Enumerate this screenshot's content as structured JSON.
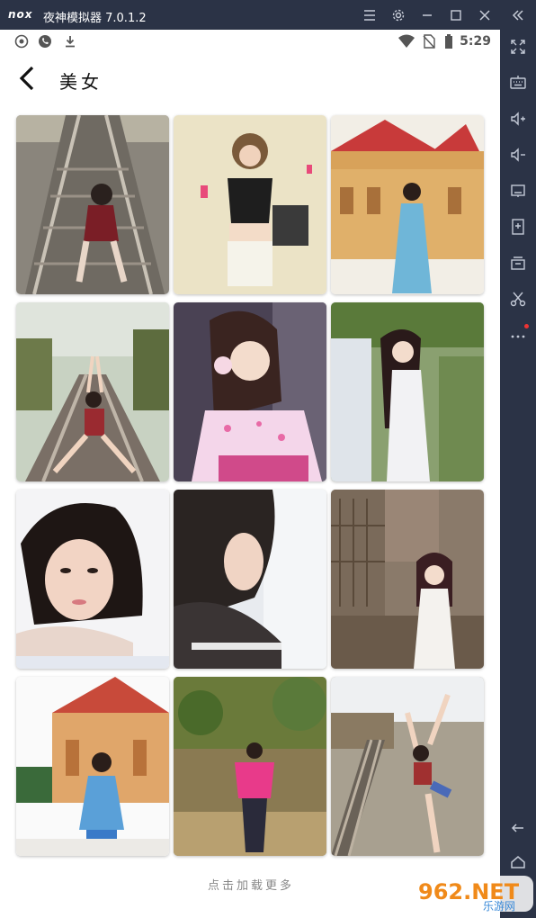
{
  "app": {
    "logo": "nox",
    "title": "夜神模拟器 7.0.1.2"
  },
  "window_controls": [
    "menu-icon",
    "gear-icon",
    "minimize-icon",
    "maximize-icon",
    "close-icon",
    "collapse-icon"
  ],
  "sidebar": {
    "tools": [
      "fullscreen-icon",
      "keyboard-icon",
      "volume-up-icon",
      "volume-down-icon",
      "screen-icon",
      "apk-install-icon",
      "multi-instance-icon",
      "scissors-icon",
      "more-icon",
      "back-icon",
      "home-icon"
    ]
  },
  "status_bar": {
    "time": "5:29",
    "left_icons": [
      "game-icon",
      "phone-icon",
      "download-icon"
    ],
    "right_icons": [
      "wifi-icon",
      "no-sim-icon",
      "battery-icon"
    ]
  },
  "header": {
    "title": "美女",
    "back_icon": "chevron-left-icon"
  },
  "gallery": {
    "photos": [
      {
        "name": "photo-railway-sitting",
        "subject": "woman sitting on railway"
      },
      {
        "name": "photo-indoor-phone",
        "subject": "woman with phone indoors"
      },
      {
        "name": "photo-temple-blue-dress",
        "subject": "woman at temple"
      },
      {
        "name": "photo-railway-pose",
        "subject": "woman posing on railway"
      },
      {
        "name": "photo-kimono",
        "subject": "woman in kimono"
      },
      {
        "name": "photo-white-dress-garden",
        "subject": "woman in white dress"
      },
      {
        "name": "photo-portrait-closeup",
        "subject": "portrait closeup"
      },
      {
        "name": "photo-profile-bw",
        "subject": "woman looking down"
      },
      {
        "name": "photo-brick-wall",
        "subject": "woman by brick wall"
      },
      {
        "name": "photo-temple-praying",
        "subject": "woman praying at temple"
      },
      {
        "name": "photo-pink-jacket",
        "subject": "woman in pink jacket"
      },
      {
        "name": "photo-railway-stretch",
        "subject": "woman stretching on railway"
      }
    ]
  },
  "footer": {
    "load_more": "点击加载更多"
  },
  "watermark": {
    "text": "962.NET",
    "subtext": "乐游网"
  },
  "colors": {
    "chrome": "#2b3346",
    "accent_red": "#e33333",
    "text_muted": "#888888"
  }
}
